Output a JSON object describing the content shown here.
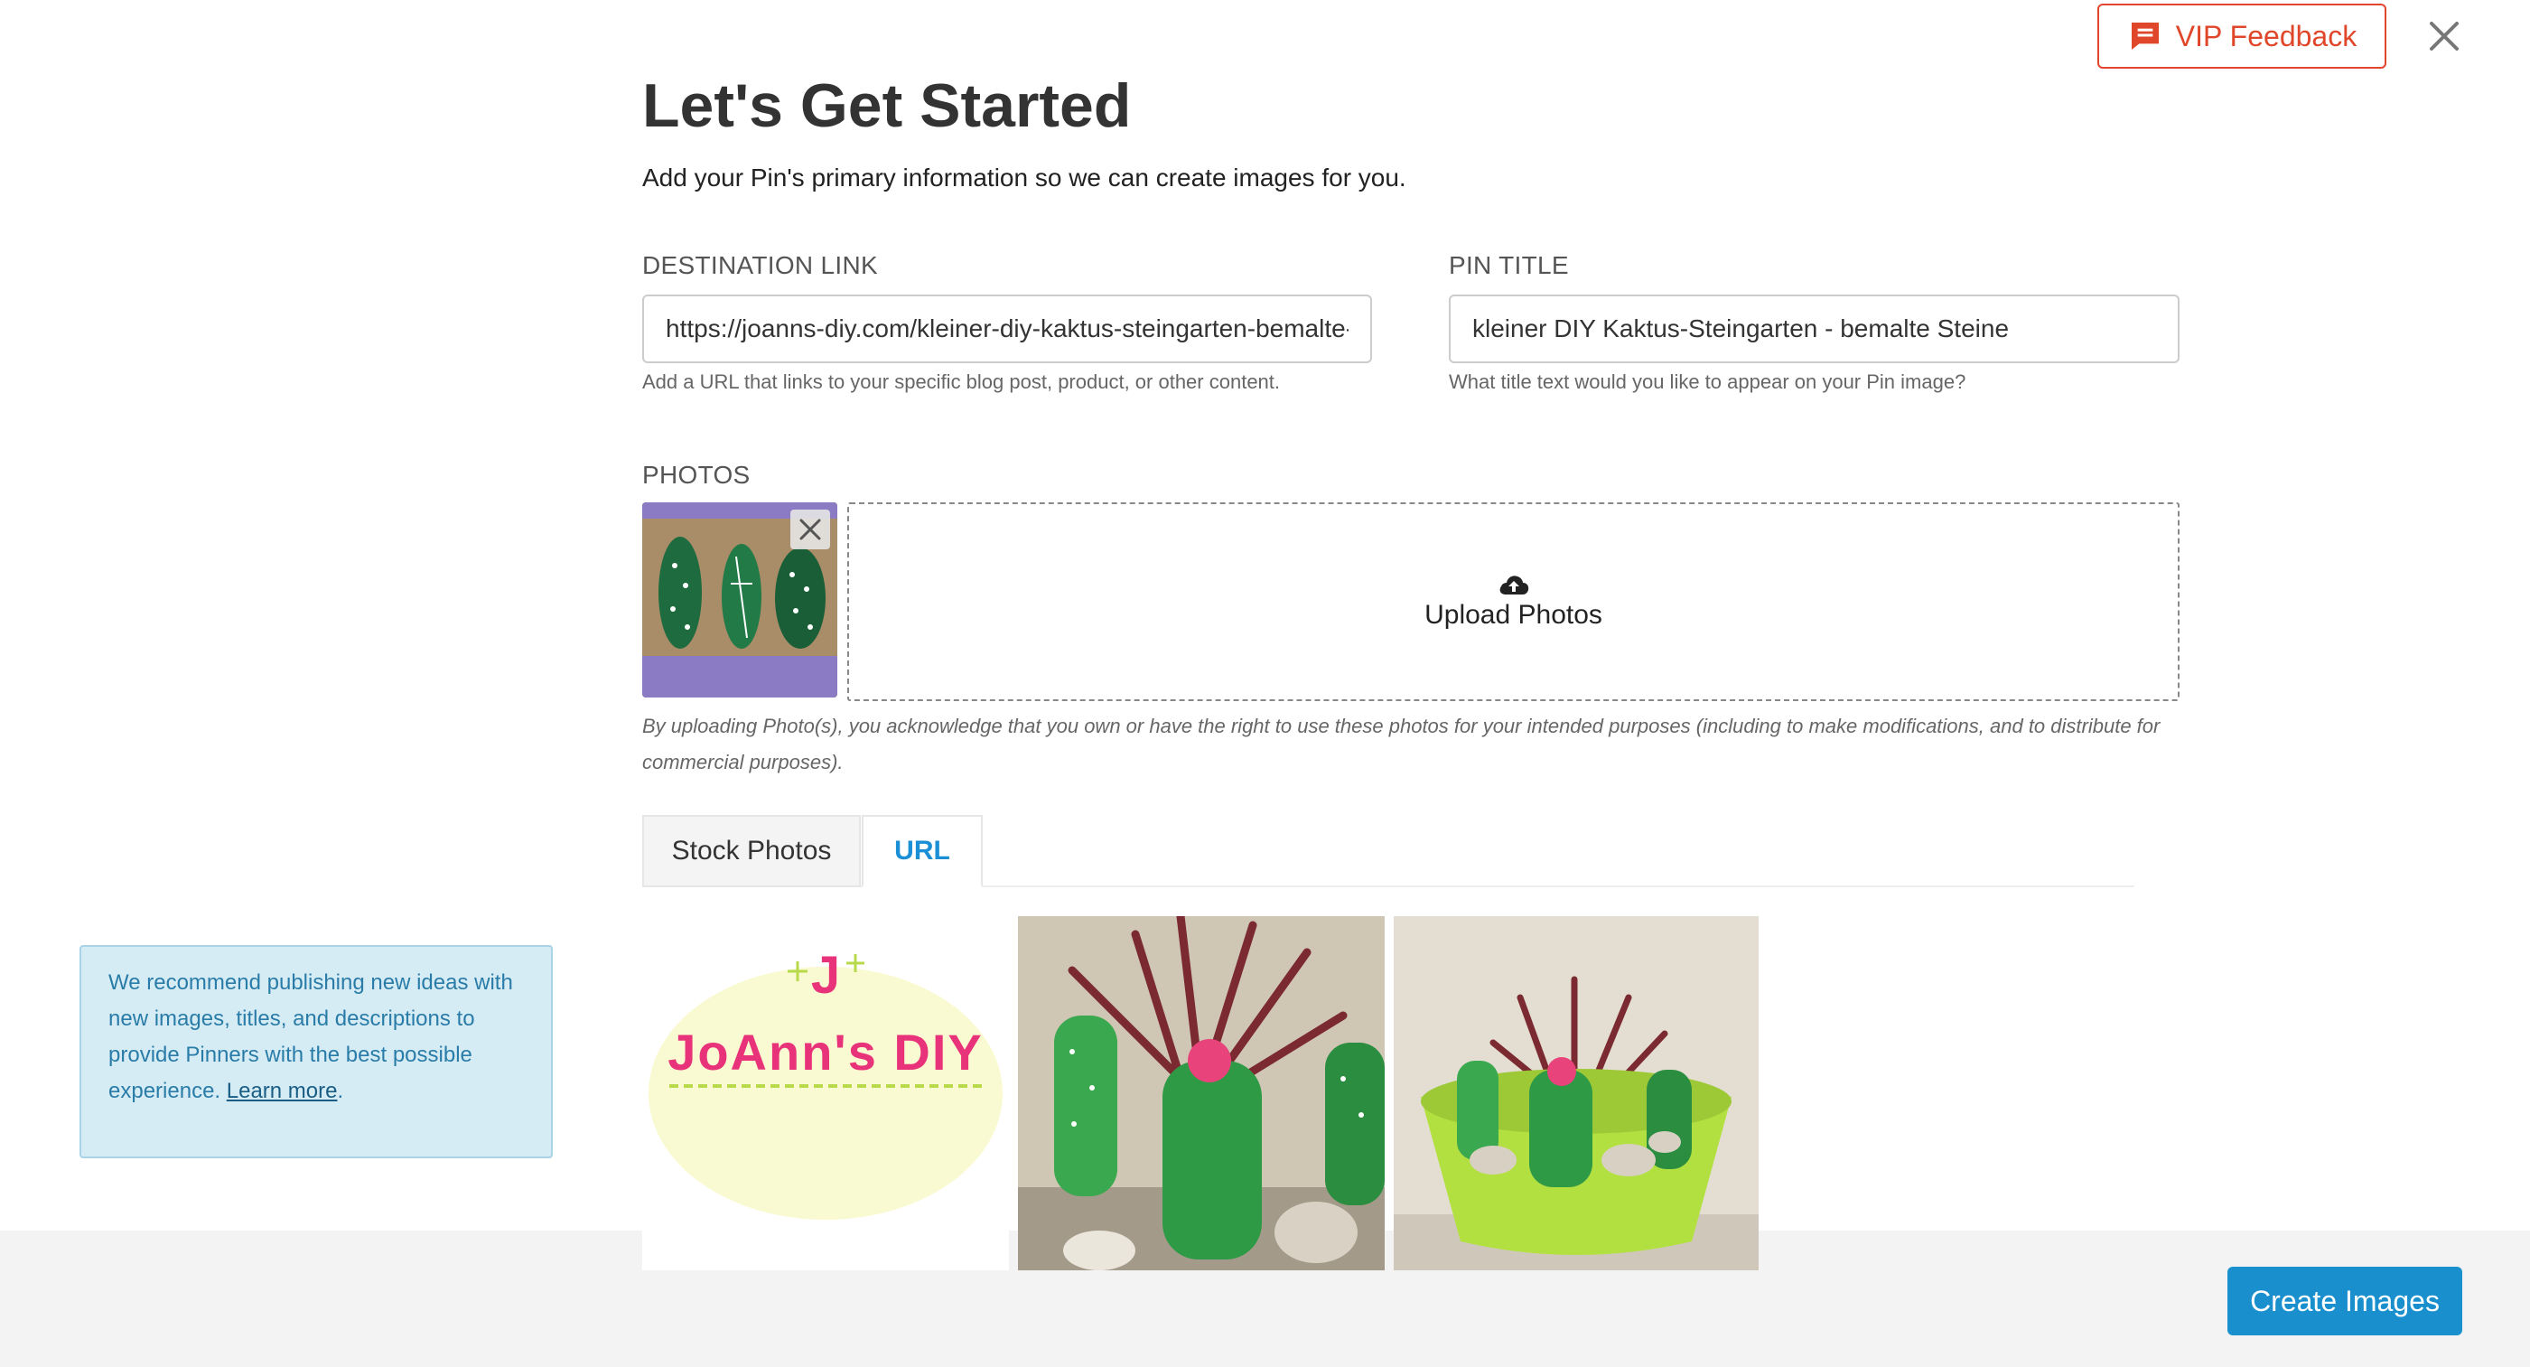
{
  "header": {
    "vip_feedback_label": "VIP Feedback",
    "title": "Let's Get Started",
    "subtitle": "Add your Pin's primary information so we can create images for you."
  },
  "destination": {
    "label": "DESTINATION LINK",
    "value": "https://joanns-diy.com/kleiner-diy-kaktus-steingarten-bemalte-steine",
    "help": "Add a URL that links to your specific blog post, product, or other content."
  },
  "pin_title": {
    "label": "PIN TITLE",
    "value": "kleiner DIY Kaktus-Steingarten - bemalte Steine",
    "help": "What title text would you like to appear on your Pin image?"
  },
  "photos": {
    "label": "PHOTOS",
    "upload_label": "Upload Photos",
    "disclaimer": "By uploading Photo(s), you acknowledge that you own or have the right to use these photos for your intended purposes (including to make modifications, and to distribute for commercial purposes)."
  },
  "tabs": [
    {
      "label": "Stock Photos",
      "active": false
    },
    {
      "label": "URL",
      "active": true
    }
  ],
  "url_images": [
    {
      "name": "JoAnn's DIY",
      "logo_letter": "J"
    },
    {
      "name": "cactus-rock-garden-1"
    },
    {
      "name": "cactus-rock-garden-2"
    }
  ],
  "recommendation": {
    "text": "We recommend publishing new ideas with new images, titles, and descriptions to provide Pinners with the best possible experience. ",
    "link": "Learn more",
    "end": "."
  },
  "footer": {
    "create_label": "Create Images"
  },
  "colors": {
    "accent_red": "#e0472a",
    "accent_blue": "#1a8fce",
    "info_bg": "#d6ecf5"
  }
}
